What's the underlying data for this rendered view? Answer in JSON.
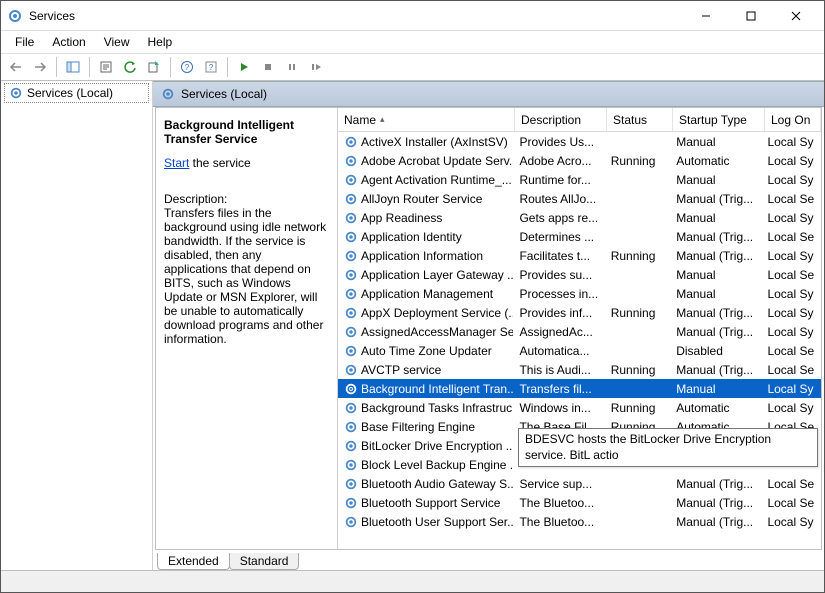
{
  "titlebar": {
    "title": "Services"
  },
  "menubar": {
    "file": "File",
    "action": "Action",
    "view": "View",
    "help": "Help"
  },
  "leftpane": {
    "root": "Services (Local)"
  },
  "rp_header": {
    "label": "Services (Local)"
  },
  "detail": {
    "name": "Background Intelligent Transfer Service",
    "start_link": "Start",
    "start_suffix": " the service",
    "desc_label": "Description:",
    "desc": "Transfers files in the background using idle network bandwidth. If the service is disabled, then any applications that depend on BITS, such as Windows Update or MSN Explorer, will be unable to automatically download programs and other information."
  },
  "columns": {
    "name": "Name",
    "desc": "Description",
    "status": "Status",
    "startup": "Startup Type",
    "logon": "Log On"
  },
  "tabs": {
    "extended": "Extended",
    "standard": "Standard"
  },
  "tooltip": "BDESVC hosts the BitLocker Drive Encryption service. BitL actio",
  "services": [
    {
      "name": "ActiveX Installer (AxInstSV)",
      "desc": "Provides Us...",
      "status": "",
      "startup": "Manual",
      "logon": "Local Sy"
    },
    {
      "name": "Adobe Acrobat Update Serv...",
      "desc": "Adobe Acro...",
      "status": "Running",
      "startup": "Automatic",
      "logon": "Local Sy"
    },
    {
      "name": "Agent Activation Runtime_...",
      "desc": "Runtime for...",
      "status": "",
      "startup": "Manual",
      "logon": "Local Sy"
    },
    {
      "name": "AllJoyn Router Service",
      "desc": "Routes AllJo...",
      "status": "",
      "startup": "Manual (Trig...",
      "logon": "Local Se"
    },
    {
      "name": "App Readiness",
      "desc": "Gets apps re...",
      "status": "",
      "startup": "Manual",
      "logon": "Local Sy"
    },
    {
      "name": "Application Identity",
      "desc": "Determines ...",
      "status": "",
      "startup": "Manual (Trig...",
      "logon": "Local Se"
    },
    {
      "name": "Application Information",
      "desc": "Facilitates t...",
      "status": "Running",
      "startup": "Manual (Trig...",
      "logon": "Local Sy"
    },
    {
      "name": "Application Layer Gateway ...",
      "desc": "Provides su...",
      "status": "",
      "startup": "Manual",
      "logon": "Local Se"
    },
    {
      "name": "Application Management",
      "desc": "Processes in...",
      "status": "",
      "startup": "Manual",
      "logon": "Local Sy"
    },
    {
      "name": "AppX Deployment Service (...",
      "desc": "Provides inf...",
      "status": "Running",
      "startup": "Manual (Trig...",
      "logon": "Local Sy"
    },
    {
      "name": "AssignedAccessManager Se...",
      "desc": "AssignedAc...",
      "status": "",
      "startup": "Manual (Trig...",
      "logon": "Local Sy"
    },
    {
      "name": "Auto Time Zone Updater",
      "desc": "Automatica...",
      "status": "",
      "startup": "Disabled",
      "logon": "Local Se"
    },
    {
      "name": "AVCTP service",
      "desc": "This is Audi...",
      "status": "Running",
      "startup": "Manual (Trig...",
      "logon": "Local Se"
    },
    {
      "name": "Background Intelligent Tran...",
      "desc": "Transfers fil...",
      "status": "",
      "startup": "Manual",
      "logon": "Local Sy",
      "selected": true
    },
    {
      "name": "Background Tasks Infrastruc...",
      "desc": "Windows in...",
      "status": "Running",
      "startup": "Automatic",
      "logon": "Local Sy"
    },
    {
      "name": "Base Filtering Engine",
      "desc": "The Base Fil...",
      "status": "Running",
      "startup": "Automatic",
      "logon": "Local Se"
    },
    {
      "name": "BitLocker Drive Encryption ...",
      "desc": "",
      "status": "",
      "startup": "",
      "logon": ""
    },
    {
      "name": "Block Level Backup Engine ...",
      "desc": "",
      "status": "",
      "startup": "",
      "logon": ""
    },
    {
      "name": "Bluetooth Audio Gateway S...",
      "desc": "Service sup...",
      "status": "",
      "startup": "Manual (Trig...",
      "logon": "Local Se"
    },
    {
      "name": "Bluetooth Support Service",
      "desc": "The Bluetoo...",
      "status": "",
      "startup": "Manual (Trig...",
      "logon": "Local Se"
    },
    {
      "name": "Bluetooth User Support Ser...",
      "desc": "The Bluetoo...",
      "status": "",
      "startup": "Manual (Trig...",
      "logon": "Local Sy"
    }
  ]
}
